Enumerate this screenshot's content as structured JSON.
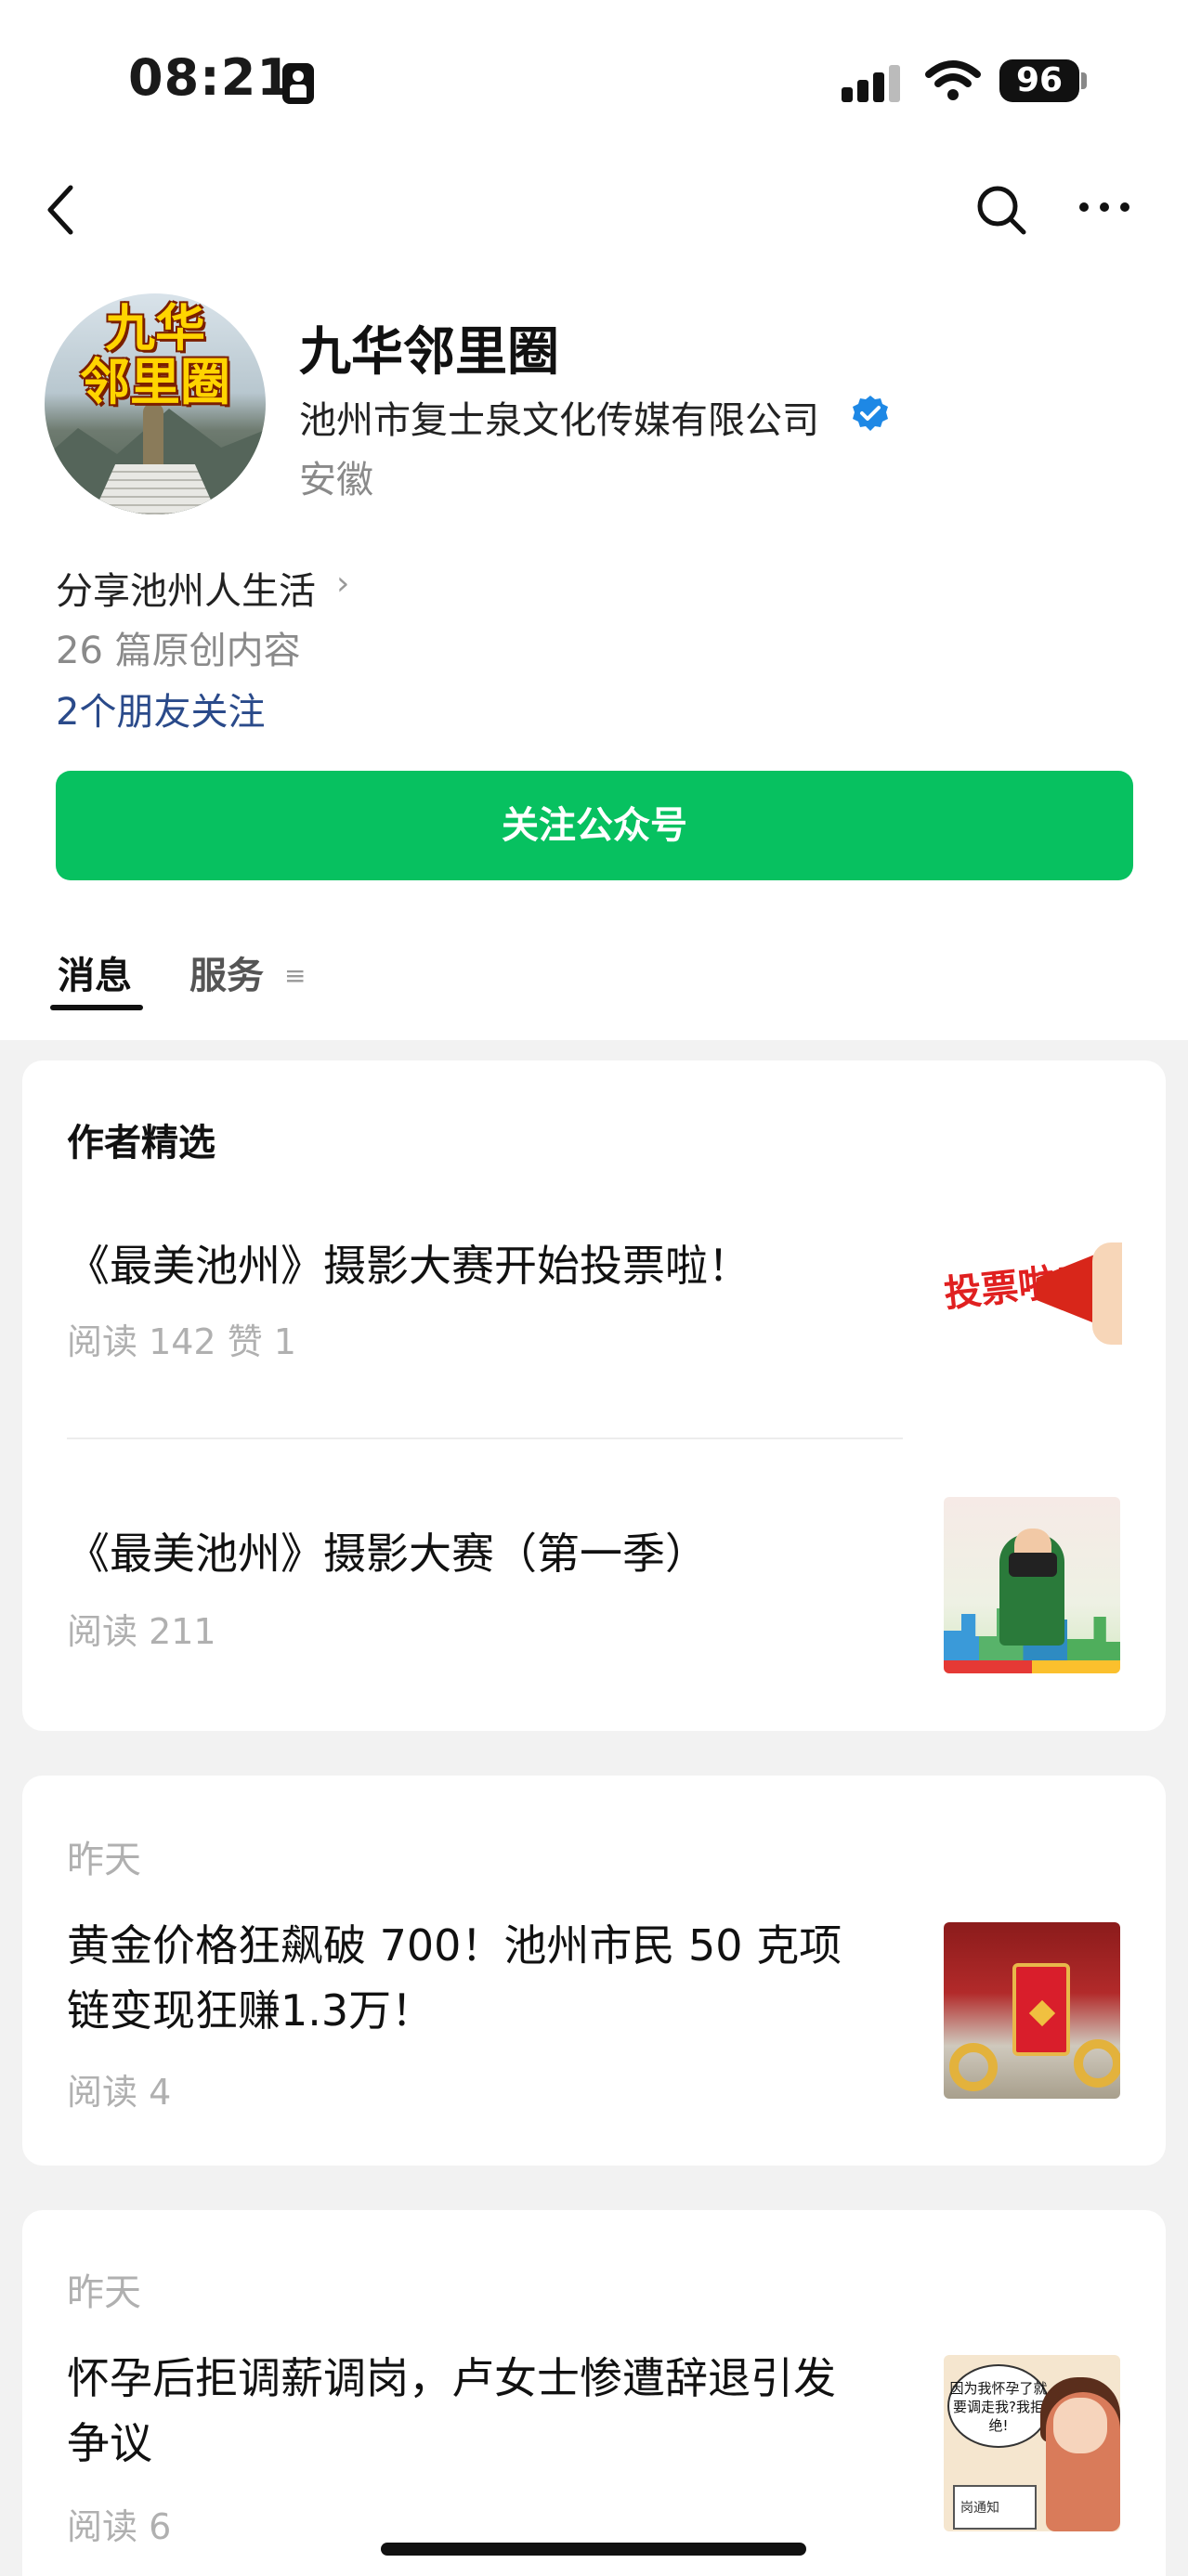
{
  "status_bar": {
    "time": "08:21",
    "battery": "96"
  },
  "profile": {
    "avatar_text_line1": "九华",
    "avatar_text_line2": "邻里圈",
    "name": "九华邻里圈",
    "company": "池州市复士泉文化传媒有限公司",
    "region": "安徽",
    "intro": "分享池州人生活",
    "original_count": "26 篇原创内容",
    "friends_following": "2个朋友关注"
  },
  "follow_button": "关注公众号",
  "tabs": [
    {
      "label": "消息",
      "active": true
    },
    {
      "label": "服务",
      "active": false
    }
  ],
  "featured": {
    "title": "作者精选",
    "articles": [
      {
        "title": "《最美池州》摄影大赛开始投票啦！",
        "meta": "阅读 142  赞 1",
        "thumb_text": "投票啦!"
      },
      {
        "title": "《最美池州》摄影大赛（第一季）",
        "meta": "阅读 211"
      }
    ]
  },
  "feed": [
    {
      "date": "昨天",
      "title_line1": "黄金价格狂飙破 700！池州市民 50 克项",
      "title_line2": "链变现狂赚1.3万！",
      "meta": "阅读 4"
    },
    {
      "date": "昨天",
      "title_line1": "怀孕后拒调薪调岗，卢女士惨遭辞退引发",
      "title_line2": "争议",
      "meta": "阅读 6",
      "thumb_bubble": "因为我怀孕了就要调走我?我拒绝!",
      "thumb_paper": "岗通知"
    }
  ],
  "colors": {
    "accent_green": "#07c160",
    "link_blue": "#2a4a8a",
    "verified_blue": "#1e88e5"
  }
}
